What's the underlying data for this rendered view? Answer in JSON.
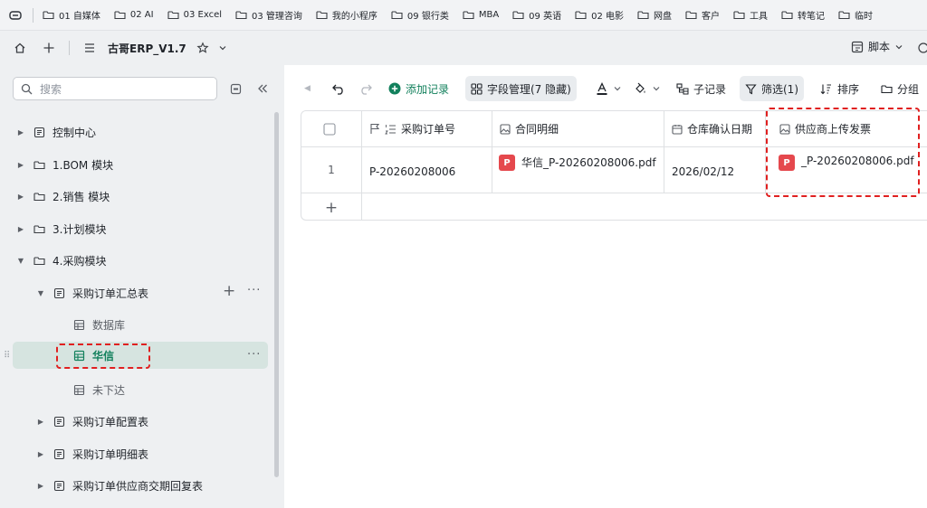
{
  "bookmarks": {
    "items": [
      "01 自媒体",
      "02 AI",
      "03 Excel",
      "03 管理咨询",
      "我的小程序",
      "09 银行类",
      "MBA",
      "09 英语",
      "02 电影",
      "网盘",
      "客户",
      "工具",
      "转笔记",
      "临时"
    ]
  },
  "title_bar": {
    "title": "古哥ERP_V1.7",
    "script_label": "脚本"
  },
  "sidebar": {
    "search_placeholder": "搜索",
    "items": [
      {
        "label": "控制中心"
      },
      {
        "label": "1.BOM 模块"
      },
      {
        "label": "2.销售 模块"
      },
      {
        "label": "3.计划模块"
      },
      {
        "label": "4.采购模块"
      },
      {
        "label": "采购订单汇总表"
      },
      {
        "label": "数据库"
      },
      {
        "label": "华信"
      },
      {
        "label": "未下达"
      },
      {
        "label": "采购订单配置表"
      },
      {
        "label": "采购订单明细表"
      },
      {
        "label": "采购订单供应商交期回复表"
      }
    ]
  },
  "toolbar": {
    "add_record": "添加记录",
    "field_manage": "字段管理(7 隐藏)",
    "sub_record": "子记录",
    "filter": "筛选(1)",
    "sort": "排序",
    "group": "分组"
  },
  "table": {
    "columns": [
      "采购订单号",
      "合同明细",
      "仓库确认日期",
      "供应商上传发票"
    ],
    "rows": [
      {
        "index": "1",
        "order_no": "P-20260208006",
        "contract_file": "华信_P-20260208006.pdf",
        "confirm_date": "2026/02/12",
        "invoice_file": "_P-20260208006.pdf"
      }
    ],
    "add_row_symbol": "+"
  },
  "colors": {
    "accent_green": "#12805c",
    "highlight_red": "#e02020",
    "pdf_red": "#e5484d",
    "selected_bg": "#d6e4e0"
  }
}
